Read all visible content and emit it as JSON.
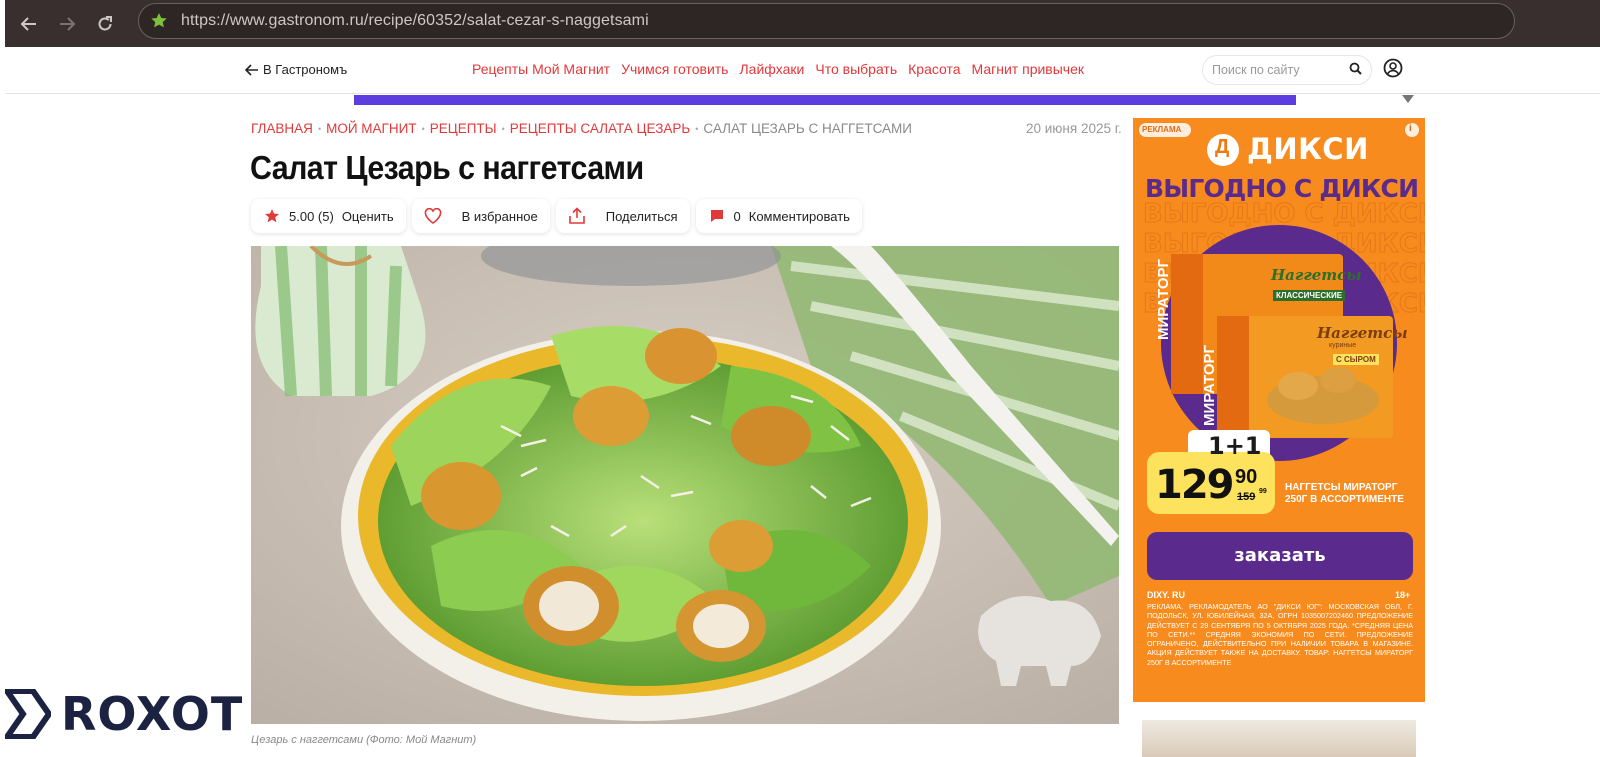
{
  "browser": {
    "url": "https://www.gastronom.ru/recipe/60352/salat-cezar-s-naggetsami",
    "back_icon": "arrow-left-icon",
    "forward_icon": "arrow-right-icon",
    "reload_icon": "reload-icon"
  },
  "topnav": {
    "back_label": "В Гастрономъ",
    "menu": [
      "Рецепты Мой Магнит",
      "Учимся готовить",
      "Лайфхаки",
      "Что выбрать",
      "Красота",
      "Магнит привычек"
    ],
    "search_placeholder": "Поиск по сайту"
  },
  "breadcrumbs": [
    "ГЛАВНАЯ",
    "МОЙ МАГНИТ",
    "РЕЦЕПТЫ",
    "РЕЦЕПТЫ САЛАТА ЦЕЗАРЬ",
    "САЛАТ ЦЕЗАРЬ С НАГГЕТСАМИ"
  ],
  "date": "20 июня 2025 г.",
  "title": "Салат Цезарь с наггетсами",
  "actions": {
    "rating_value": "5.00 (5)",
    "rate_label": "Оценить",
    "favorite_label": "В избранное",
    "share_label": "Поделиться",
    "comments_count": "0",
    "comment_label": "Комментировать"
  },
  "photo_caption": "Цезарь с наггетсами (Фото: Мой Магнит)",
  "ad": {
    "badge": "РЕКЛАМА",
    "brand": "ДИКСИ",
    "brand_letter": "Д",
    "headline": "ВЫГОДНО С ДИКСИ",
    "product_brand": "МИРАТОРГ",
    "product_name": "Наггетсы",
    "product_sub": "куриные",
    "variant_1": "КЛАССИЧЕСКИЕ",
    "variant_2": "С СЫРОМ",
    "promo": "1+1",
    "price_main": "129",
    "price_kop": "90",
    "price_old": "159",
    "price_old_kop": "99",
    "product_desc_1": "НАГГЕТСЫ МИРАТОРГ",
    "product_desc_2": "250Г В АССОРТИМЕНТЕ",
    "cta": "заказать",
    "site": "DIXY. RU",
    "age": "18+",
    "legal": "РЕКЛАМА. РЕКЛАМОДАТЕЛЬ АО \"ДИКСИ ЮГ\": МОСКОВСКАЯ ОБЛ, Г. ПОДОЛЬСК, УЛ. ЮБИЛЕЙНАЯ, 32А, ОГРН 1035007202460 ПРЕДЛОЖЕНИЕ ДЕЙСТВУЕТ С 29 СЕНТЯБРЯ ПО 5 ОКТЯБРЯ 2025 ГОДА. *СРЕДНЯЯ ЦЕНА ПО СЕТИ.** СРЕДНЯЯ ЭКОНОМИЯ ПО СЕТИ. ПРЕДЛОЖЕНИЕ ОГРАНИЧЕНО, ДЕЙСТВИТЕЛЬНО ПРИ НАЛИЧИИ ТОВАРА В МАГАЗИНЕ. АКЦИЯ ДЕЙСТВУЕТ ТАКЖЕ НА ДОСТАВКУ. ТОВАР: НАГГЕТСЫ МИРАТОРГ 250Г В АССОРТИМЕНТЕ"
  },
  "watermark": "ROXOT",
  "colors": {
    "accent": "#e2383a",
    "ad_orange": "#f78b1e",
    "ad_purple": "#5a2a8c",
    "promo_bar": "#5b3de0"
  }
}
